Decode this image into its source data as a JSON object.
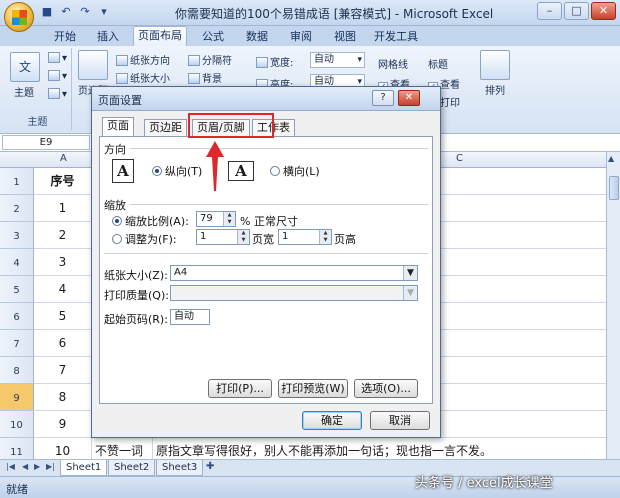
{
  "window": {
    "title": "你需要知道的100个易错成语 [兼容模式] - Microsoft Excel",
    "controls": [
      "–",
      "□",
      "✕"
    ]
  },
  "ribbon_tabs": [
    "开始",
    "插入",
    "页面布局",
    "公式",
    "数据",
    "审阅",
    "视图",
    "开发工具"
  ],
  "ribbon": {
    "theme": {
      "label": "主题",
      "group": "主题",
      "text_badge": "文"
    },
    "page_setup": {
      "margins": "页边距",
      "orientation": "纸张方向",
      "size": "纸张大小",
      "breaks": "分隔符",
      "background": "背景"
    },
    "scale": {
      "width_label": "宽度:",
      "width_value": "自动",
      "height_label": "高度:",
      "height_value": "自动"
    },
    "sheet_options": {
      "gridlines": "网格线",
      "headings": "标题",
      "view1": "查看",
      "view2": "查看",
      "print": "打印"
    },
    "arrange": "排列"
  },
  "formula_bar": {
    "name_box": "E9"
  },
  "columns": [
    "A",
    "C"
  ],
  "rows": [
    {
      "num": "1",
      "a": "序号",
      "b": "",
      "c": ""
    },
    {
      "num": "2",
      "a": "1",
      "b": "",
      "c": "。"
    },
    {
      "num": "3",
      "a": "2",
      "b": "",
      "c": ""
    },
    {
      "num": "4",
      "a": "3",
      "b": "",
      "c": ""
    },
    {
      "num": "5",
      "a": "4",
      "b": "",
      "c": "观念。"
    },
    {
      "num": "6",
      "a": "5",
      "b": "",
      "c": ""
    },
    {
      "num": "7",
      "a": "6",
      "b": "",
      "c": ""
    },
    {
      "num": "8",
      "a": "7",
      "b": "",
      "c": "容贫穷。"
    },
    {
      "num": "9",
      "a": "8",
      "b": "",
      "c": "而非听者不理解。"
    },
    {
      "num": "10",
      "a": "9",
      "b": "",
      "c": "放心上。"
    },
    {
      "num": "11",
      "a": "10",
      "b": "不赞一词",
      "c": "原指文章写得很好，别人不能再添加一句话；现也指一言不发。"
    }
  ],
  "sheets": [
    "Sheet1",
    "Sheet2",
    "Sheet3"
  ],
  "status": {
    "ready": "就绪"
  },
  "watermark": "头条号 / excel成长课堂",
  "dialog": {
    "title": "页面设置",
    "tabs": [
      "页面",
      "页边距",
      "页眉/页脚",
      "工作表"
    ],
    "orientation_section": "方向",
    "portrait": "纵向(T)",
    "landscape": "横向(L)",
    "icon_letter": "A",
    "scale_section": "缩放",
    "adjust_to_label": "缩放比例(A):",
    "adjust_to_value": "79",
    "adjust_to_suffix": "% 正常尺寸",
    "fit_to_label": "调整为(F):",
    "fit_wide_value": "1",
    "fit_wide_suffix": "页宽",
    "fit_tall_value": "1",
    "fit_tall_suffix": "页高",
    "paper_size_label": "纸张大小(Z):",
    "paper_size_value": "A4",
    "print_quality_label": "打印质量(Q):",
    "print_quality_value": "",
    "first_page_label": "起始页码(R):",
    "first_page_value": "自动",
    "print_button": "打印(P)...",
    "preview_button": "打印预览(W)",
    "options_button": "选项(O)...",
    "ok_button": "确定",
    "cancel_button": "取消"
  },
  "colors": {
    "highlight": "#d92b2b",
    "accent": "#23478a"
  }
}
